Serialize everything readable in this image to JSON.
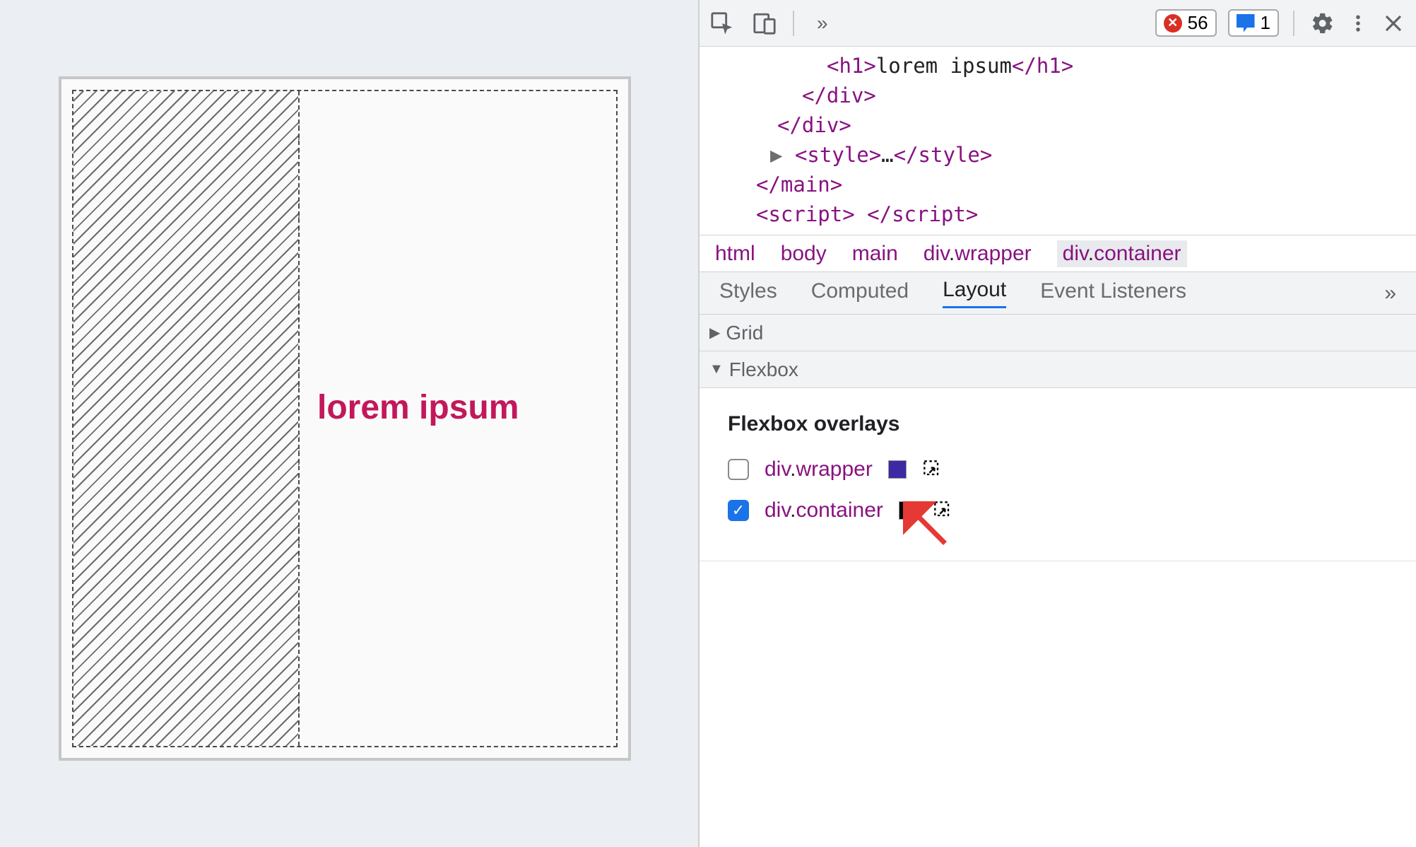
{
  "canvas": {
    "heading": "lorem ipsum"
  },
  "toolbar": {
    "errors": "56",
    "messages": "1"
  },
  "code": {
    "line1": {
      "open": "<h1>",
      "text": "lorem ipsum",
      "close": "</h1>"
    },
    "line2": "</div>",
    "line3": "</div>",
    "line4": {
      "pre": "▶",
      "open": "<style>",
      "mid": "…",
      "close": "</style>"
    },
    "line5": "</main>",
    "line6": {
      "open": "<script>",
      "mid": " ",
      "close": "</script>"
    }
  },
  "breadcrumb": {
    "items": [
      "html",
      "body",
      "main",
      "div.wrapper",
      "div.container"
    ],
    "selected": "div.container"
  },
  "tabs": {
    "items": [
      "Styles",
      "Computed",
      "Layout",
      "Event Listeners"
    ],
    "active": "Layout"
  },
  "sections": {
    "grid": {
      "title": "Grid"
    },
    "flexbox": {
      "title": "Flexbox"
    }
  },
  "flexbox_panel": {
    "heading": "Flexbox overlays",
    "overlays": [
      {
        "label": "div.wrapper",
        "checked": false,
        "swatch": "purple"
      },
      {
        "label": "div.container",
        "checked": true,
        "swatch": "black"
      }
    ]
  }
}
